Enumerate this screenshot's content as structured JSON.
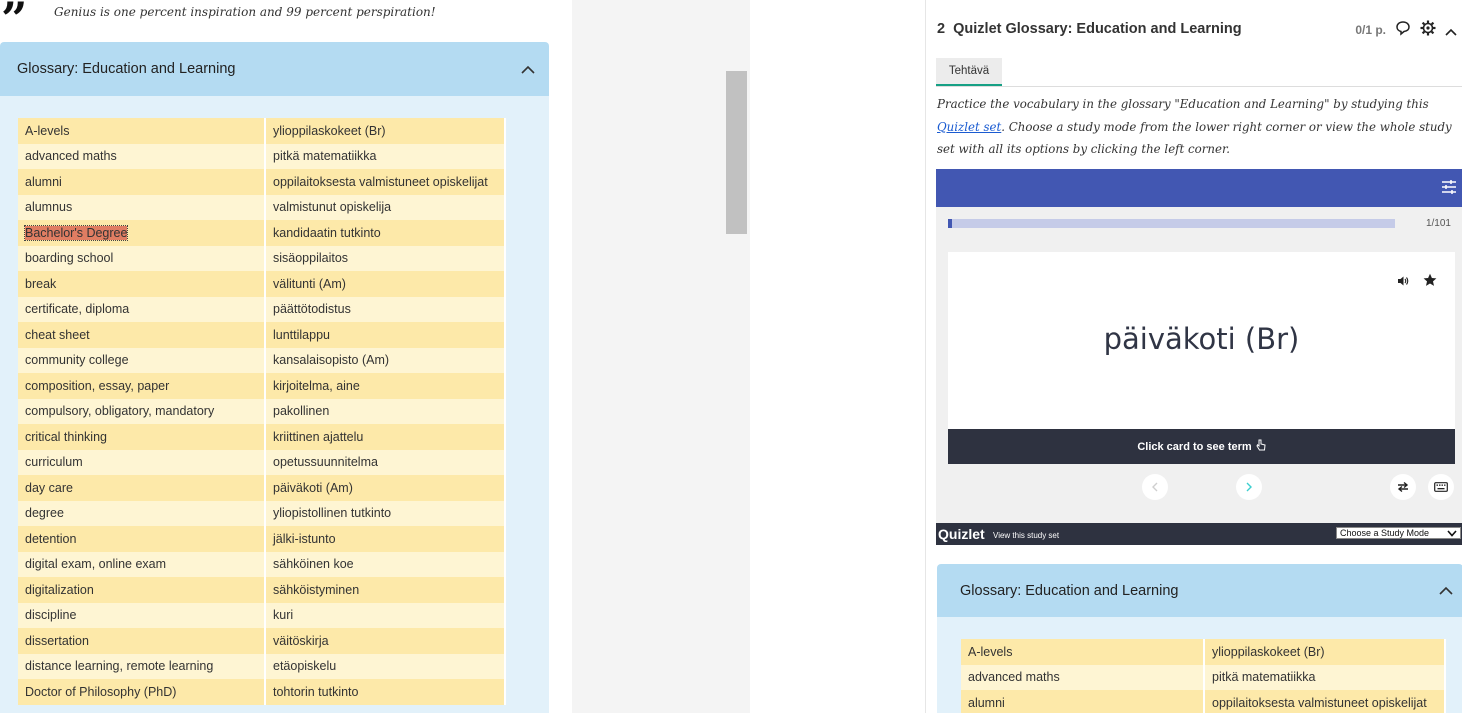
{
  "quote": {
    "mark": "”",
    "text": "Genius is one percent inspiration and 99 percent perspiration!"
  },
  "glossary": {
    "title": "Glossary: Education and Learning",
    "rows": [
      [
        "A-levels",
        "ylioppilaskokeet (Br)"
      ],
      [
        "advanced maths",
        "pitkä matematiikka"
      ],
      [
        "alumni",
        "oppilaitoksesta valmistuneet opiskelijat"
      ],
      [
        "alumnus",
        "valmistunut opiskelija"
      ],
      [
        "Bachelor's Degree",
        "kandidaatin tutkinto"
      ],
      [
        "boarding school",
        "sisäoppilaitos"
      ],
      [
        "break",
        "välitunti (Am)"
      ],
      [
        "certificate, diploma",
        "päättötodistus"
      ],
      [
        "cheat sheet",
        "lunttilappu"
      ],
      [
        "community college",
        "kansalaisopisto (Am)"
      ],
      [
        "composition, essay, paper",
        "kirjoitelma, aine"
      ],
      [
        "compulsory, obligatory, mandatory",
        "pakollinen"
      ],
      [
        "critical thinking",
        "kriittinen ajattelu"
      ],
      [
        "curriculum",
        "opetussuunnitelma"
      ],
      [
        "day care",
        "päiväkoti (Am)"
      ],
      [
        "degree",
        "yliopistollinen tutkinto"
      ],
      [
        "detention",
        "jälki-istunto"
      ],
      [
        "digital exam, online exam",
        "sähköinen koe"
      ],
      [
        "digitalization",
        "sähköistyminen"
      ],
      [
        "discipline",
        "kuri"
      ],
      [
        "dissertation",
        "väitöskirja"
      ],
      [
        "distance learning, remote learning",
        "etäopiskelu"
      ],
      [
        "Doctor of Philosophy (PhD)",
        "tohtorin tutkinto"
      ]
    ],
    "right_rows": [
      [
        "A-levels",
        "ylioppilaskokeet (Br)"
      ],
      [
        "advanced maths",
        "pitkä matematiikka"
      ],
      [
        "alumni",
        "oppilaitoksesta valmistuneet opiskelijat"
      ]
    ]
  },
  "task": {
    "number": "2",
    "title": "Quizlet Glossary: Education and Learning",
    "points": "0/1 p.",
    "tab": "Tehtävä",
    "instr_before": "Practice the vocabulary in the glossary \"Education and Learning\" by studying this ",
    "instr_link": "Quizlet set",
    "instr_after": ". Choose a study mode from the lower right corner or view the whole study set with all its options by clicking the left corner."
  },
  "quizlet": {
    "progress_fraction": 0.0099,
    "counter": "1/101",
    "card_word": "päiväkoti (Br)",
    "flip_label": "Click card to see term",
    "logo": "Quizlet",
    "view_link": "View this study set",
    "study_mode": "Choose a Study Mode"
  },
  "colors": {
    "accordion": "#b4dbf2",
    "row_odd": "#fde9a9",
    "row_even": "#fef5d3",
    "quizlet_blue": "#4257b2",
    "quizlet_dark": "#2e3240"
  }
}
